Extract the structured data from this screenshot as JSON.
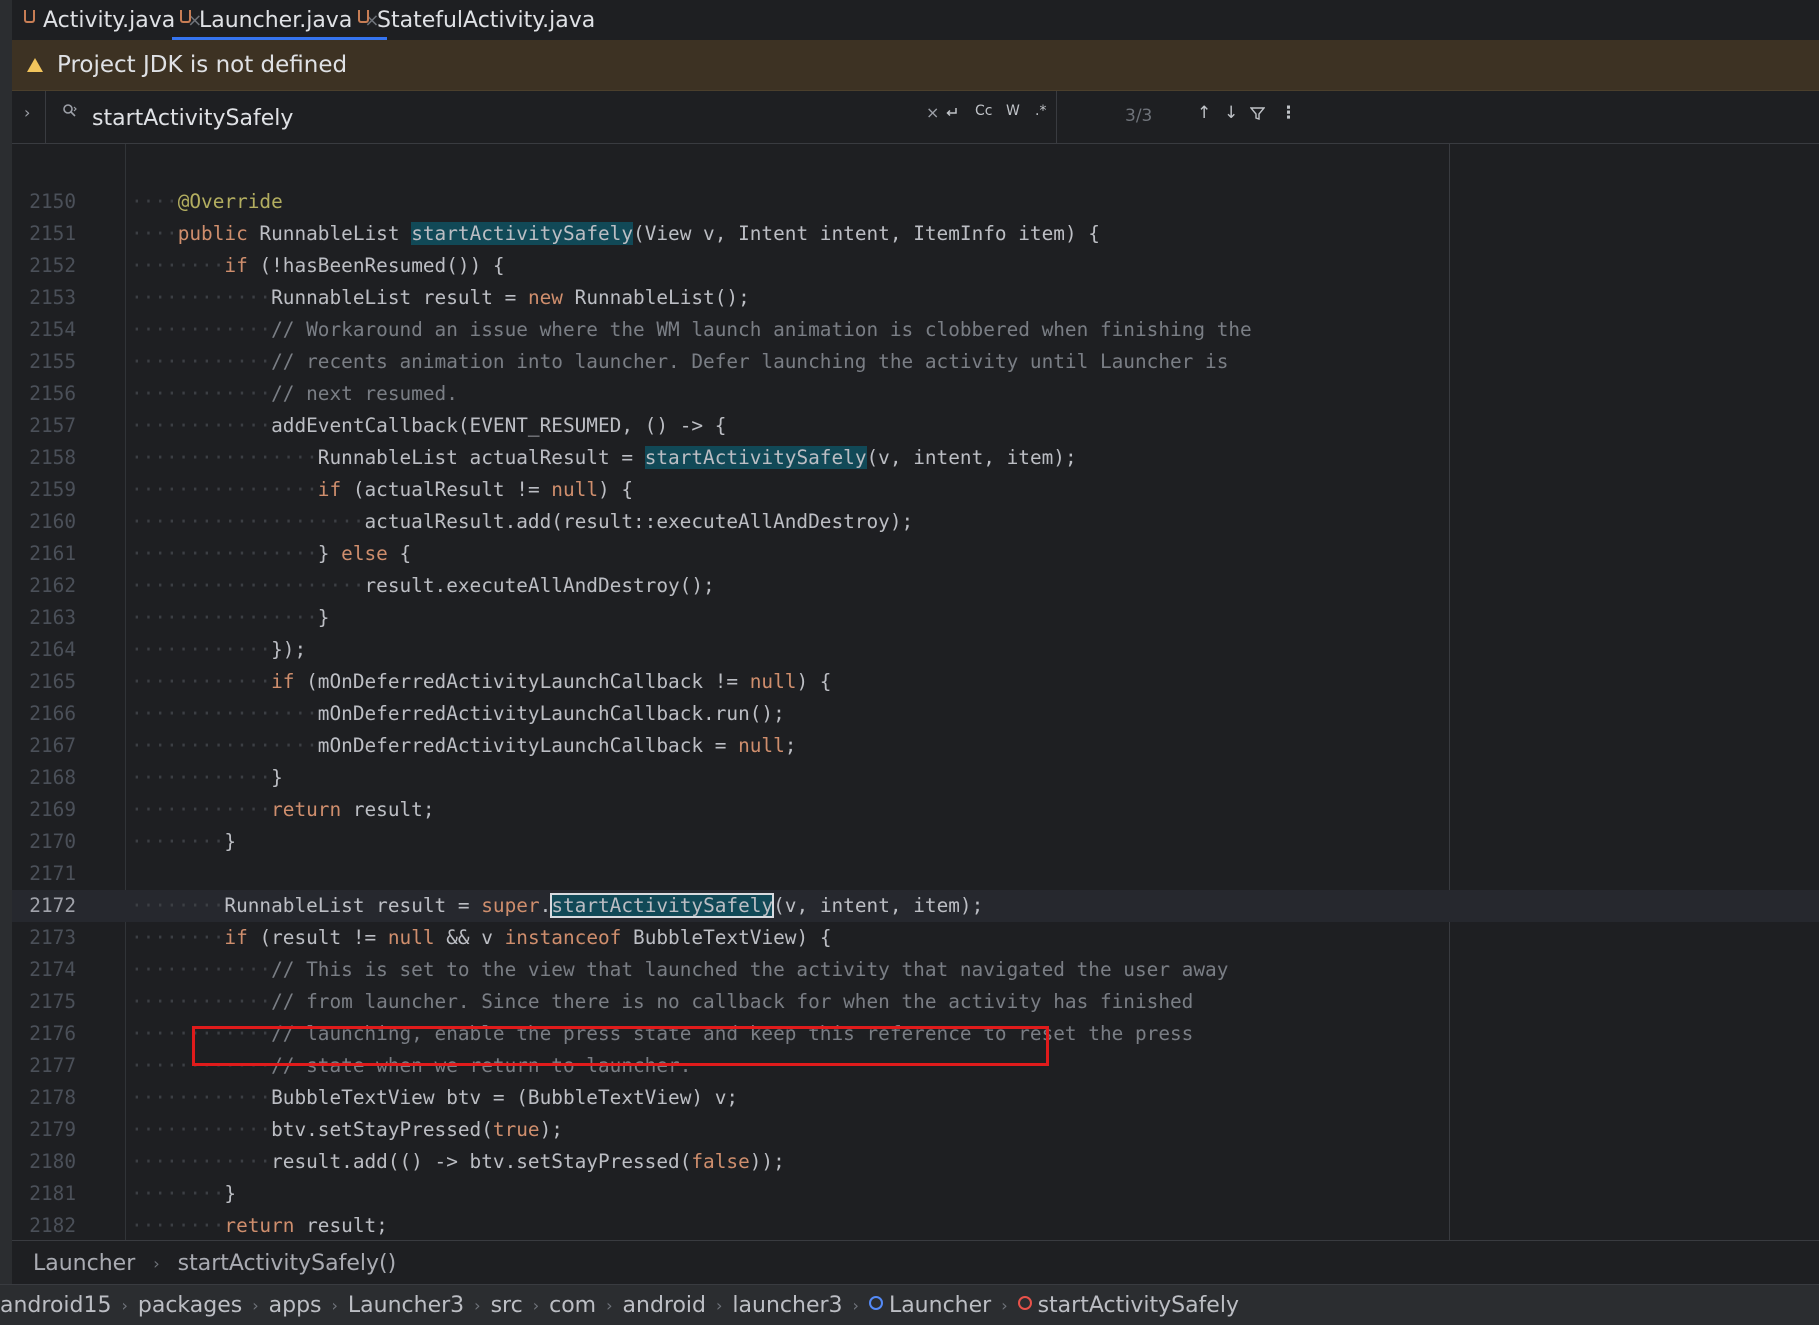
{
  "tabs": [
    {
      "label": "Activity.java",
      "active": false,
      "closable": true
    },
    {
      "label": "Launcher.java",
      "active": true,
      "closable": true
    },
    {
      "label": "StatefulActivity.java",
      "active": false,
      "closable": false
    }
  ],
  "banner": {
    "text": "Project JDK is not defined"
  },
  "search": {
    "value": "startActivitySafely",
    "match_count": "3/3",
    "clear_glyph": "×",
    "options": [
      "Cc",
      "W",
      ".*"
    ]
  },
  "editor": {
    "lines": [
      {
        "num": "2150",
        "dots": 4,
        "parts": [
          {
            "t": "an",
            "v": "@Override"
          }
        ]
      },
      {
        "num": "2151",
        "dots": 4,
        "parts": [
          {
            "t": "kw",
            "v": "public"
          },
          {
            "t": "x",
            "v": " RunnableList "
          },
          {
            "t": "hl",
            "v": "startActivitySafely"
          },
          {
            "t": "x",
            "v": "(View v, Intent intent, ItemInfo item) {"
          }
        ]
      },
      {
        "num": "2152",
        "dots": 8,
        "parts": [
          {
            "t": "kw",
            "v": "if"
          },
          {
            "t": "x",
            "v": " (!hasBeenResumed()) {"
          }
        ]
      },
      {
        "num": "2153",
        "dots": 12,
        "parts": [
          {
            "t": "x",
            "v": "RunnableList result = "
          },
          {
            "t": "kw",
            "v": "new"
          },
          {
            "t": "x",
            "v": " RunnableList();"
          }
        ]
      },
      {
        "num": "2154",
        "dots": 12,
        "parts": [
          {
            "t": "cm",
            "v": "// Workaround an issue where the WM launch animation is clobbered when finishing the"
          }
        ]
      },
      {
        "num": "2155",
        "dots": 12,
        "parts": [
          {
            "t": "cm",
            "v": "// recents animation into launcher. Defer launching the activity until Launcher is"
          }
        ]
      },
      {
        "num": "2156",
        "dots": 12,
        "parts": [
          {
            "t": "cm",
            "v": "// next resumed."
          }
        ]
      },
      {
        "num": "2157",
        "dots": 12,
        "parts": [
          {
            "t": "x",
            "v": "addEventCallback(EVENT_RESUMED, () -> {"
          }
        ]
      },
      {
        "num": "2158",
        "dots": 16,
        "parts": [
          {
            "t": "x",
            "v": "RunnableList actualResult = "
          },
          {
            "t": "hl",
            "v": "startActivitySafely"
          },
          {
            "t": "x",
            "v": "(v, intent, item);"
          }
        ]
      },
      {
        "num": "2159",
        "dots": 16,
        "parts": [
          {
            "t": "kw",
            "v": "if"
          },
          {
            "t": "x",
            "v": " (actualResult != "
          },
          {
            "t": "kw",
            "v": "null"
          },
          {
            "t": "x",
            "v": ") {"
          }
        ]
      },
      {
        "num": "2160",
        "dots": 20,
        "parts": [
          {
            "t": "x",
            "v": "actualResult.add(result::executeAllAndDestroy);"
          }
        ]
      },
      {
        "num": "2161",
        "dots": 16,
        "parts": [
          {
            "t": "x",
            "v": "} "
          },
          {
            "t": "kw",
            "v": "else"
          },
          {
            "t": "x",
            "v": " {"
          }
        ]
      },
      {
        "num": "2162",
        "dots": 20,
        "parts": [
          {
            "t": "x",
            "v": "result.executeAllAndDestroy();"
          }
        ]
      },
      {
        "num": "2163",
        "dots": 16,
        "parts": [
          {
            "t": "x",
            "v": "}"
          }
        ]
      },
      {
        "num": "2164",
        "dots": 12,
        "parts": [
          {
            "t": "x",
            "v": "});"
          }
        ]
      },
      {
        "num": "2165",
        "dots": 12,
        "parts": [
          {
            "t": "kw",
            "v": "if"
          },
          {
            "t": "x",
            "v": " (mOnDeferredActivityLaunchCallback != "
          },
          {
            "t": "kw",
            "v": "null"
          },
          {
            "t": "x",
            "v": ") {"
          }
        ]
      },
      {
        "num": "2166",
        "dots": 16,
        "parts": [
          {
            "t": "x",
            "v": "mOnDeferredActivityLaunchCallback.run();"
          }
        ]
      },
      {
        "num": "2167",
        "dots": 16,
        "parts": [
          {
            "t": "x",
            "v": "mOnDeferredActivityLaunchCallback = "
          },
          {
            "t": "kw",
            "v": "null"
          },
          {
            "t": "x",
            "v": ";"
          }
        ]
      },
      {
        "num": "2168",
        "dots": 12,
        "parts": [
          {
            "t": "x",
            "v": "}"
          }
        ]
      },
      {
        "num": "2169",
        "dots": 12,
        "parts": [
          {
            "t": "kw",
            "v": "return"
          },
          {
            "t": "x",
            "v": " result;"
          }
        ]
      },
      {
        "num": "2170",
        "dots": 8,
        "parts": [
          {
            "t": "x",
            "v": "}"
          }
        ]
      },
      {
        "num": "2171",
        "dots": 0,
        "parts": []
      },
      {
        "num": "2172",
        "dots": 8,
        "current": true,
        "parts": [
          {
            "t": "x",
            "v": "RunnableList result = "
          },
          {
            "t": "kw",
            "v": "super"
          },
          {
            "t": "x",
            "v": "."
          },
          {
            "t": "hlc",
            "v": "startActivitySafely"
          },
          {
            "t": "x",
            "v": "(v, intent, item);"
          }
        ]
      },
      {
        "num": "2173",
        "dots": 8,
        "parts": [
          {
            "t": "kw",
            "v": "if"
          },
          {
            "t": "x",
            "v": " (result != "
          },
          {
            "t": "kw",
            "v": "null"
          },
          {
            "t": "x",
            "v": " && v "
          },
          {
            "t": "kw",
            "v": "instanceof"
          },
          {
            "t": "x",
            "v": " BubbleTextView) {"
          }
        ]
      },
      {
        "num": "2174",
        "dots": 12,
        "parts": [
          {
            "t": "cm",
            "v": "// This is set to the view that launched the activity that navigated the user away"
          }
        ]
      },
      {
        "num": "2175",
        "dots": 12,
        "parts": [
          {
            "t": "cm",
            "v": "// from launcher. Since there is no callback for when the activity has finished"
          }
        ]
      },
      {
        "num": "2176",
        "dots": 12,
        "parts": [
          {
            "t": "cm",
            "v": "// launching, enable the press state and keep this reference to reset the press"
          }
        ]
      },
      {
        "num": "2177",
        "dots": 12,
        "parts": [
          {
            "t": "cm",
            "v": "// state when we return to launcher."
          }
        ]
      },
      {
        "num": "2178",
        "dots": 12,
        "parts": [
          {
            "t": "x",
            "v": "BubbleTextView btv = (BubbleTextView) v;"
          }
        ]
      },
      {
        "num": "2179",
        "dots": 12,
        "parts": [
          {
            "t": "x",
            "v": "btv.setStayPressed("
          },
          {
            "t": "kw",
            "v": "true"
          },
          {
            "t": "x",
            "v": ");"
          }
        ]
      },
      {
        "num": "2180",
        "dots": 12,
        "parts": [
          {
            "t": "x",
            "v": "result.add(() -> btv.setStayPressed("
          },
          {
            "t": "kw",
            "v": "false"
          },
          {
            "t": "x",
            "v": "));"
          }
        ]
      },
      {
        "num": "2181",
        "dots": 8,
        "parts": [
          {
            "t": "x",
            "v": "}"
          }
        ]
      },
      {
        "num": "2182",
        "dots": 8,
        "parts": [
          {
            "t": "kw",
            "v": "return"
          },
          {
            "t": "x",
            "v": " result;"
          }
        ]
      }
    ]
  },
  "editor_breadcrumb": {
    "class_name": "Launcher",
    "method_name": "startActivitySafely()"
  },
  "status_path": [
    {
      "label": "android15",
      "icon": ""
    },
    {
      "label": "packages",
      "icon": ""
    },
    {
      "label": "apps",
      "icon": ""
    },
    {
      "label": "Launcher3",
      "icon": ""
    },
    {
      "label": "src",
      "icon": ""
    },
    {
      "label": "com",
      "icon": ""
    },
    {
      "label": "android",
      "icon": ""
    },
    {
      "label": "launcher3",
      "icon": ""
    },
    {
      "label": "Launcher",
      "icon": "class-icon"
    },
    {
      "label": "startActivitySafely",
      "icon": "method-icon"
    }
  ],
  "colors": {
    "keyword": "#cf8e6d",
    "comment": "#7a7e85",
    "annotation": "#b3ae60",
    "search_highlight": "#114957",
    "annotation_box": "#e01b1b",
    "accent": "#3574f0"
  }
}
